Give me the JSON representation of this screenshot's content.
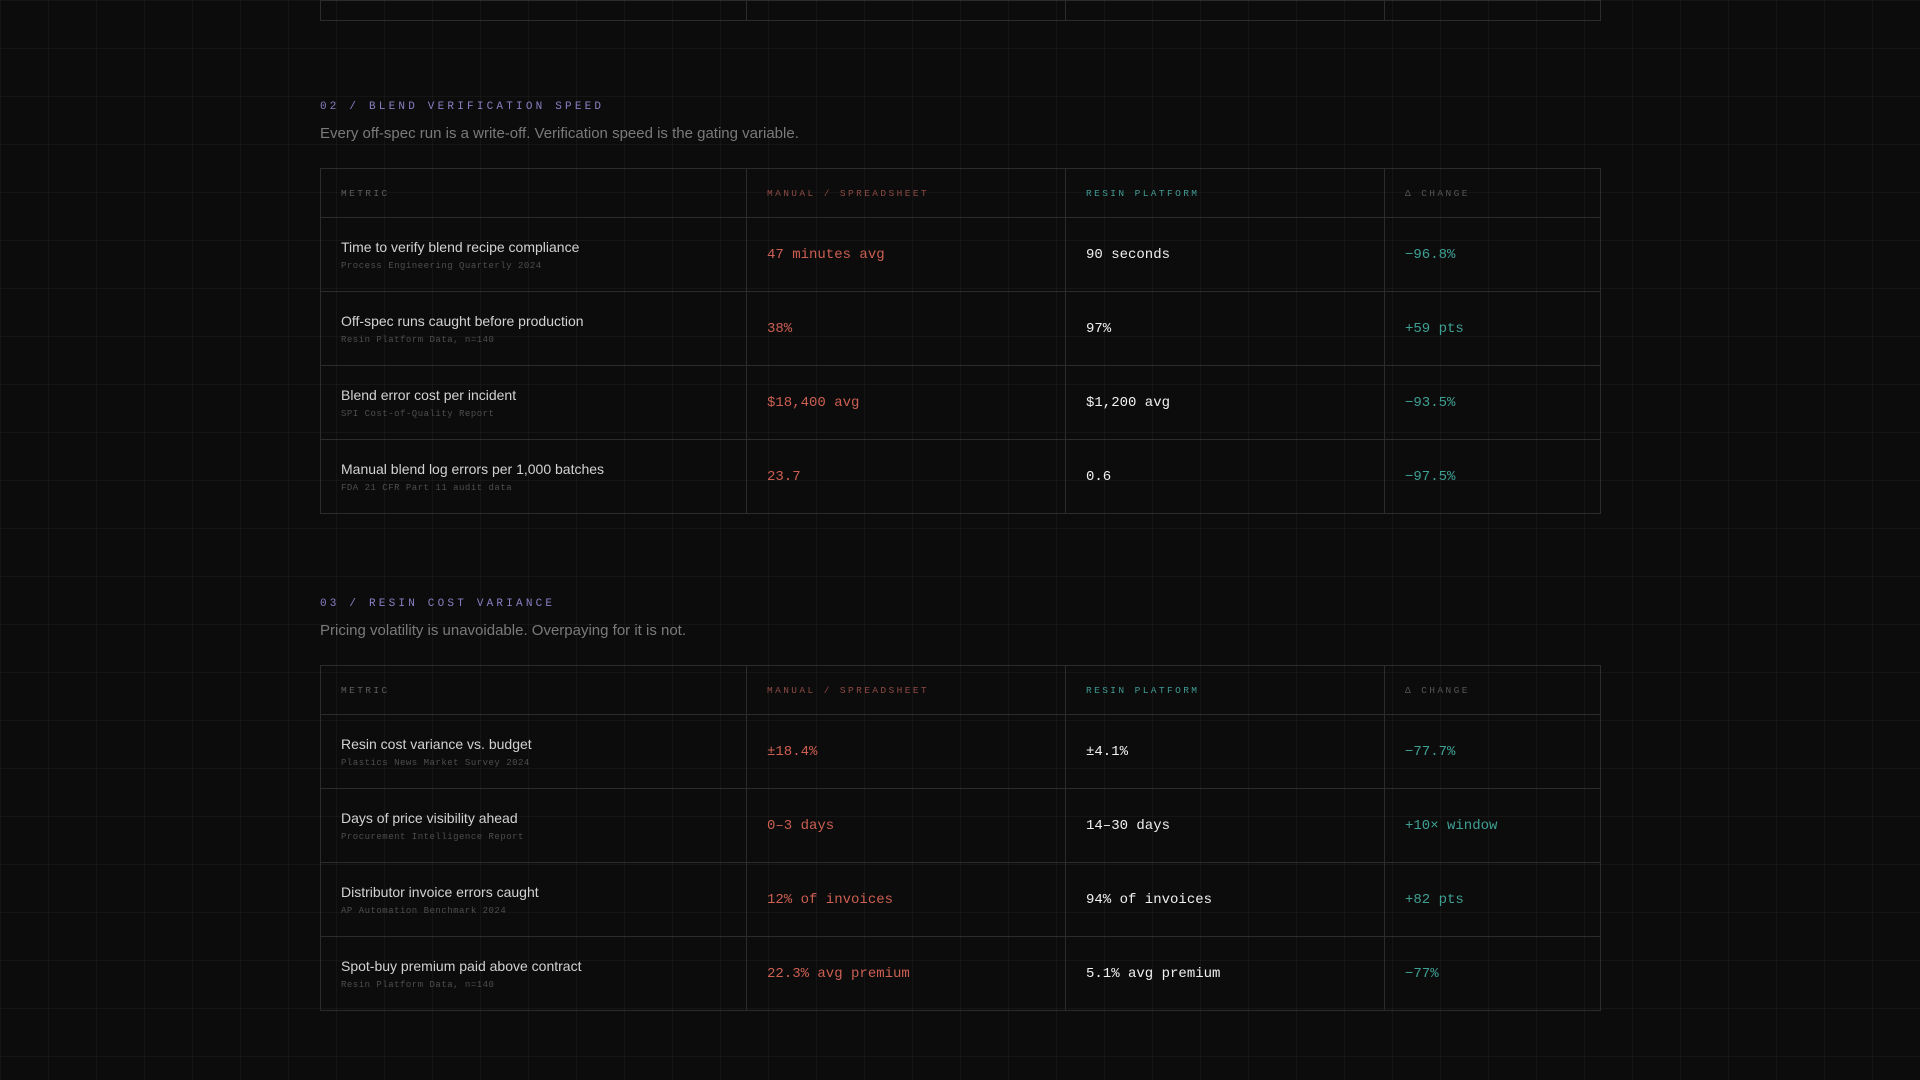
{
  "sections": [
    {
      "label": "02 / BLEND VERIFICATION SPEED",
      "subtitle": "Every off-spec run is a write-off. Verification speed is the gating variable.",
      "headers": [
        "METRIC",
        "MANUAL / SPREADSHEET",
        "RESIN PLATFORM",
        "Δ CHANGE"
      ],
      "rows": [
        {
          "title": "Time to verify blend recipe compliance",
          "source": "Process Engineering Quarterly 2024",
          "manual": "47 minutes avg",
          "platform": "90 seconds",
          "change": "−96.8%"
        },
        {
          "title": "Off-spec runs caught before production",
          "source": "Resin Platform Data, n=140",
          "manual": "38%",
          "platform": "97%",
          "change": "+59 pts"
        },
        {
          "title": "Blend error cost per incident",
          "source": "SPI Cost-of-Quality Report",
          "manual": "$18,400 avg",
          "platform": "$1,200 avg",
          "change": "−93.5%"
        },
        {
          "title": "Manual blend log errors per 1,000 batches",
          "source": "FDA 21 CFR Part 11 audit data",
          "manual": "23.7",
          "platform": "0.6",
          "change": "−97.5%"
        }
      ]
    },
    {
      "label": "03 / RESIN COST VARIANCE",
      "subtitle": "Pricing volatility is unavoidable. Overpaying for it is not.",
      "headers": [
        "METRIC",
        "MANUAL / SPREADSHEET",
        "RESIN PLATFORM",
        "Δ CHANGE"
      ],
      "rows": [
        {
          "title": "Resin cost variance vs. budget",
          "source": "Plastics News Market Survey 2024",
          "manual": "±18.4%",
          "platform": "±4.1%",
          "change": "−77.7%"
        },
        {
          "title": "Days of price visibility ahead",
          "source": "Procurement Intelligence Report",
          "manual": "0–3 days",
          "platform": "14–30 days",
          "change": "+10× window"
        },
        {
          "title": "Distributor invoice errors caught",
          "source": "AP Automation Benchmark 2024",
          "manual": "12% of invoices",
          "platform": "94% of invoices",
          "change": "+82 pts"
        },
        {
          "title": "Spot-buy premium paid above contract",
          "source": "Resin Platform Data, n=140",
          "manual": "22.3% avg premium",
          "platform": "5.1% avg premium",
          "change": "−77%"
        }
      ]
    }
  ]
}
